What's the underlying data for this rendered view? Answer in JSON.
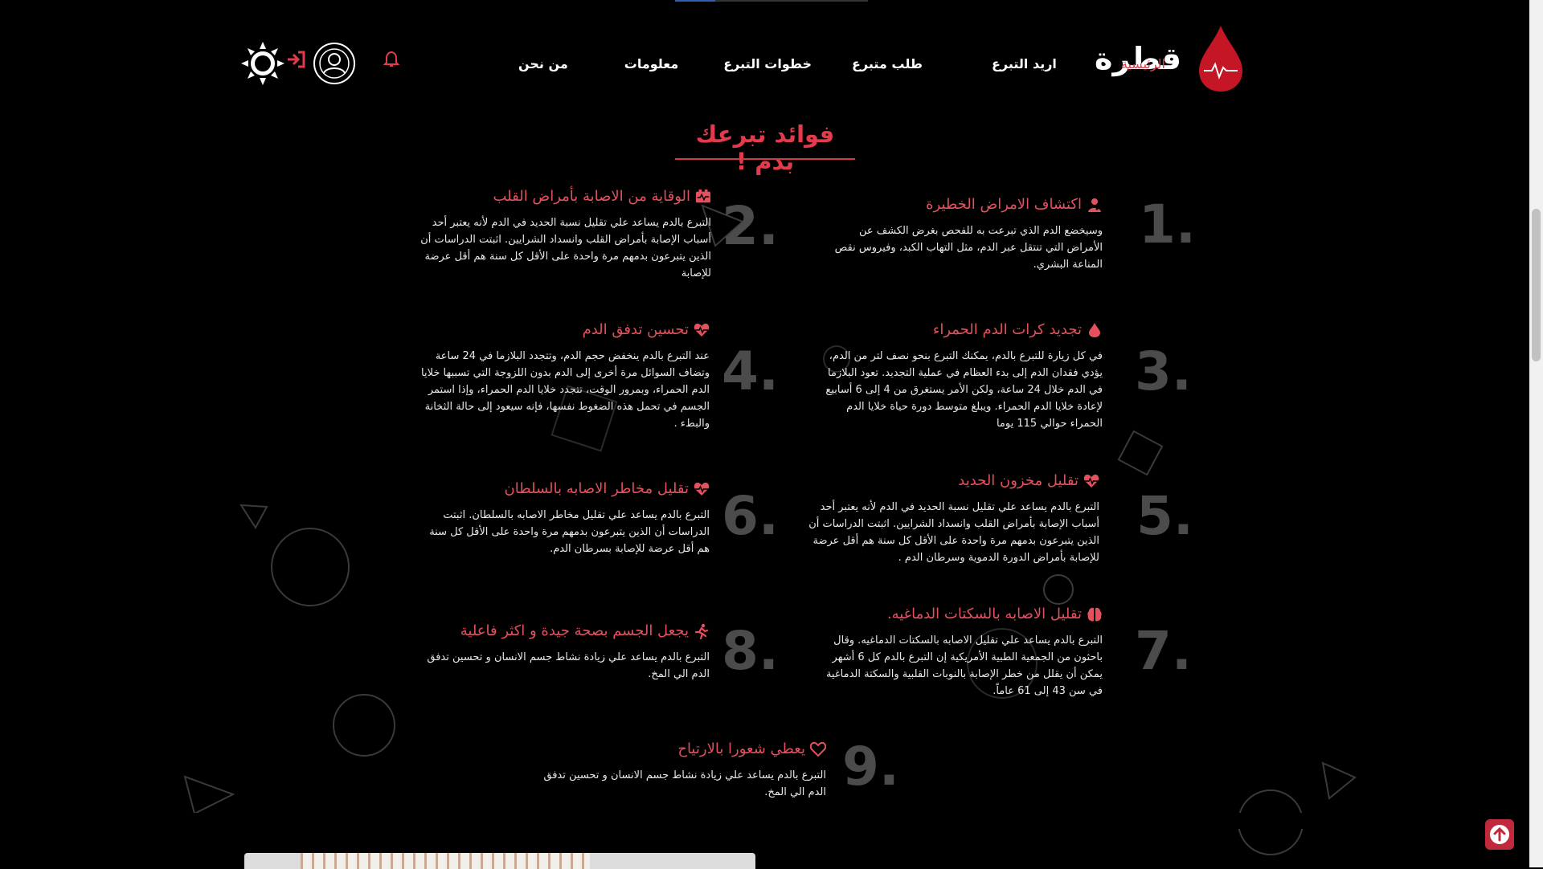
{
  "header": {
    "brand_name": "قطرة",
    "nav": [
      {
        "label": "الرئيسية",
        "active": true
      },
      {
        "label": "اريد التبرع"
      },
      {
        "label": "طلب متبرع"
      },
      {
        "label": "خطوات التبرع"
      },
      {
        "label": "معلومات"
      },
      {
        "label": "من نحن"
      }
    ],
    "icons": [
      "sun-icon",
      "sign-in-icon",
      "user-avatar-icon",
      "bell-icon"
    ]
  },
  "section": {
    "title": "فوائد تبرعك بدم !",
    "benefits": [
      {
        "num": "1.",
        "title": "اكتشاف الامراض الخطيرة",
        "icon": "user-doctor-icon",
        "desc": "وسيخضع الدم الذي تبرعت به للفحص بغرض الكشف عن الأمراض التي تنتقل عبر الدم، مثل التهاب الكبد، وفيروس نقص المناعة البشري."
      },
      {
        "num": "2.",
        "title": "الوقاية من الاصابة بأمراض القلب",
        "icon": "heart-rate-card-icon",
        "desc": "التبرع بالدم يساعد علي تقليل نسبة الحديد في الدم لأنه يعتبر أحد أسباب الإصابة بأمراض القلب وانسداد الشرايين. اثبتت الدراسات أن الذين يتبرعون بدمهم مرة واحدة على الأقل كل سنة هم أقل عرضة للإصابة"
      },
      {
        "num": "3.",
        "title": "تجديد كرات الدم الحمراء",
        "icon": "blood-drop-icon",
        "desc": "في كل زيارة للتبرع بالدم، يمكنك التبرع بنحو نصف لتر من الدم، يؤدي فقدان الدم إلى بدء العظام في عملية التجديد. تعود البلازما في الدم خلال 24 ساعة، ولكن الأمر يستغرق من 4 إلى 6 أسابيع لإعادة خلايا الدم الحمراء. ويبلغ متوسط دورة حياة خلايا الدم الحمراء حوالي 115 يوما"
      },
      {
        "num": "4.",
        "title": "تحسين تدفق الدم",
        "icon": "heart-pulse-icon",
        "desc": "عند التبرع بالدم ينخفض حجم الدم، وتتجدد البلازما في 24 ساعة وتضاف السوائل مرة أخرى إلى الدم بدون اللزوجة التي تسببها خلايا الدم الحمراء، وبمرور الوقت، تتجدد خلايا الدم الحمراء، وإذا استمر الجسم في تحمل هذه الضغوط نفسها، فإنه سيعود إلى حالة الثخانة والبطء ."
      },
      {
        "num": "5.",
        "title": "تقليل مخزون الحديد",
        "icon": "heart-pulse-icon",
        "desc": "التبرع بالدم يساعد علي تقليل نسبة الحديد في الدم لأنه يعتبر أحد أسباب الإصابة بأمراض القلب وانسداد الشرايين. اثبتت الدراسات أن الذين يتبرعون بدمهم مرة واحدة على الأقل كل سنة هم أقل عرضة للإصابة بأمراض الدورة الدموية وسرطان الدم ."
      },
      {
        "num": "6.",
        "title": "تقليل مخاطر الاصابه بالسلطان",
        "icon": "heart-pulse-icon",
        "desc": "التبرع بالدم يساعد علي تقليل مخاطر الاصابه بالسلطان. اثبتت الدراسات أن الذين يتبرعون بدمهم مرة واحدة على الأقل كل سنة هم أقل عرضة للإصابة بسرطان الدم."
      },
      {
        "num": "7.",
        "title": "تقليل الاصابه بالسكتات الدماغيه.",
        "icon": "brain-icon",
        "desc": "التبرع بالدم يساعد علي تقليل الاصابه بالسكتات الدماغيه. وقال باحثون من الجمعية الطبية الأمريكية إن التبرع بالدم كل 6 أشهر يمكن أن يقلل من خطر الإصابة بالنوبات القلبية والسكتة الدماغية في سن 43 إلى 61 عاماً."
      },
      {
        "num": "8.",
        "title": "يجعل الجسم بصحة جيدة و اكثر فاعلية",
        "icon": "running-person-icon",
        "desc": "التبرع بالدم يساعد علي زيادة نشاط جسم الانسان و تحسين تدفق الدم الي المخ."
      },
      {
        "num": "9.",
        "title": "يعطي شعورا بالارتياح",
        "icon": "heart-outline-icon",
        "desc": "التبرع بالدم يساعد علي زيادة نشاط جسم الانسان و تحسين تدفق الدم الي المخ."
      }
    ]
  },
  "colors": {
    "accent": "#e43b4c",
    "background": "#000000",
    "number": "#4b4b4b"
  },
  "scroll_top_icon": "arrow-up-icon"
}
